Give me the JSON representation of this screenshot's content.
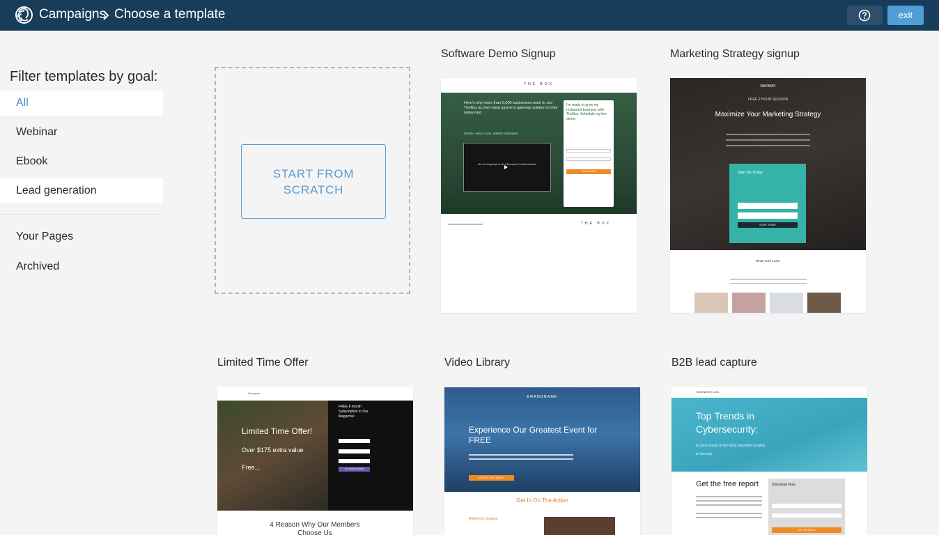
{
  "header": {
    "logo_icon": "spiral-logo-icon",
    "breadcrumb": [
      "Campaigns",
      "Choose a template"
    ],
    "help_icon": "question-circle-icon",
    "exit_label": "exit"
  },
  "sidebar": {
    "title": "Filter templates by goal:",
    "goals": [
      {
        "label": "All",
        "active": true
      },
      {
        "label": "Webinar"
      },
      {
        "label": "Ebook"
      },
      {
        "label": "Lead generation"
      }
    ],
    "sections": [
      {
        "label": "Your Pages"
      },
      {
        "label": "Archived"
      }
    ]
  },
  "scratch": {
    "label_line1": "START FROM",
    "label_line2": "SCRATCH"
  },
  "templates": [
    {
      "title": "Software Demo Signup",
      "preview": {
        "brand": "THE BOX",
        "headline": "Here's why more than 5,000 businesses want to use TheBox as their ideal payment gateway solution in their restaurant.",
        "subline": "Simple, easy to use, trusted customers",
        "video_caption": "We are bring back to life a thousand of small business",
        "form_title": "I'm ready to grow my restaurant business with TheBox. Schedule my live demo.",
        "button": "Schedule Me"
      }
    },
    {
      "title": "Marketing Strategy signup",
      "preview": {
        "brand": "NAVIWAY",
        "kicker": "FREE 2 HOUR SESSION",
        "headline": "Maximize Your Marketing Strategy",
        "form_title": "Sign Up Today",
        "button": "START TODAY",
        "section": "What You'll Learn"
      }
    },
    {
      "title": "Limited Time Offer",
      "preview": {
        "brand": "Groupmix",
        "headline": "Limited Time Offer!",
        "line2": "Over $175 extra value",
        "line3": "Free...",
        "side": "FREE 6 month Subscription to Our Magazine!",
        "button": "Get 6 Months FREE",
        "footer": "4 Reason Why Our Members Choose Us"
      }
    },
    {
      "title": "Video Library",
      "preview": {
        "brand": "BRANDNAME",
        "headline": "Experience Our Greatest Event for FREE",
        "button": "ACCESS THE LIBRARY",
        "section": "Get In On The Action",
        "sub": "Relive the Classes"
      }
    },
    {
      "title": "B2B lead capture",
      "preview": {
        "brand": "BUSINESS | LOG",
        "headline": "Top Trends in Cybersecurity:",
        "sub": "A Quick Guide to the Most Important Insights in Security",
        "section": "Get the free report",
        "form_title": "Download Now",
        "button": "Get Free Report"
      }
    }
  ]
}
